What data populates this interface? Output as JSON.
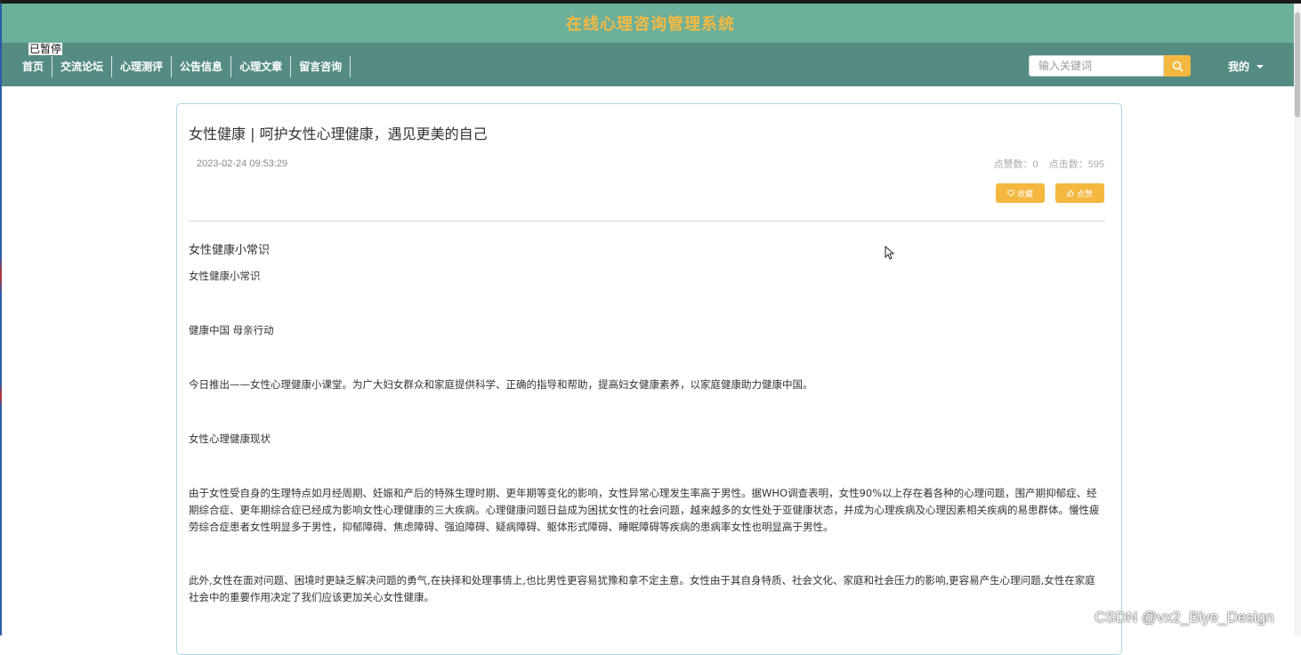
{
  "header": {
    "site_title": "在线心理咨询管理系统",
    "paused_label": "已暂停"
  },
  "nav": {
    "items": [
      {
        "label": "首页"
      },
      {
        "label": "交流论坛"
      },
      {
        "label": "心理测评"
      },
      {
        "label": "公告信息"
      },
      {
        "label": "心理文章"
      },
      {
        "label": "留言咨询"
      }
    ],
    "search_placeholder": "输入关键词",
    "search_icon": "search-icon",
    "user_menu_label": "我的",
    "user_menu_icon": "caret-down-icon"
  },
  "article": {
    "title": "女性健康 | 呵护女性心理健康，遇见更美的自己",
    "date": "2023-02-24 09:53:29",
    "likes_label": "点赞数：0",
    "clicks_label": "点击数：595",
    "favorite_button": "收藏",
    "favorite_icon": "heart-icon",
    "like_button": "点赞",
    "like_icon": "thumb-up-icon",
    "section_heading": "女性健康小常识",
    "paragraphs": [
      "女性健康小常识",
      "健康中国 母亲行动",
      "今日推出——女性心理健康小课堂。为广大妇女群众和家庭提供科学、正确的指导和帮助，提高妇女健康素养，以家庭健康助力健康中国。",
      "女性心理健康现状",
      "由于女性受自身的生理特点如月经周期、妊娠和产后的特殊生理时期、更年期等变化的影响，女性异常心理发生率高于男性。据WHO调查表明，女性90%以上存在着各种的心理问题，围产期抑郁症、经期综合症、更年期综合症已经成为影响女性心理健康的三大疾病。心理健康问题日益成为困扰女性的社会问题，越来越多的女性处于亚健康状态，并成为心理疾病及心理因素相关疾病的易患群体。慢性疲劳综合症患者女性明显多于男性，抑郁障碍、焦虑障碍、强迫障碍、疑病障碍、躯体形式障碍、睡眠障碍等疾病的患病率女性也明显高于男性。",
      "此外,女性在面对问题、困境时更缺乏解决问题的勇气,在抉择和处理事情上,也比男性更容易犹豫和拿不定主意。女性由于其自身特质、社会文化、家庭和社会压力的影响,更容易产生心理问题,女性在家庭社会中的重要作用决定了我们应该更加关心女性健康。"
    ]
  },
  "watermark": "CSDN @vx2_Biye_Design",
  "colors": {
    "title_bar": "#6bb09a",
    "nav_bar": "#548c84",
    "accent": "#f4b73f",
    "title_text": "#f5b942"
  }
}
